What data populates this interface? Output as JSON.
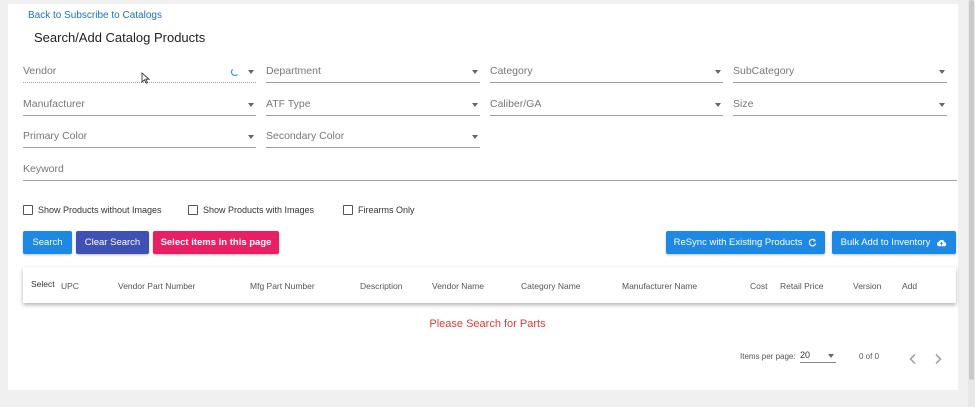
{
  "nav": {
    "back_label": "Back to Subscribe to Catalogs"
  },
  "page": {
    "title": "Search/Add Catalog Products"
  },
  "filters": {
    "vendor": "Vendor",
    "department": "Department",
    "category": "Category",
    "subcategory": "SubCategory",
    "manufacturer": "Manufacturer",
    "atf_type": "ATF Type",
    "caliber": "Caliber/GA",
    "size": "Size",
    "primary_color": "Primary Color",
    "secondary_color": "Secondary Color",
    "keyword": "Keyword"
  },
  "checkboxes": {
    "without_images": "Show Products without Images",
    "with_images": "Show Products with Images",
    "firearms_only": "Firearms Only"
  },
  "buttons": {
    "search": "Search",
    "clear": "Clear Search",
    "select_page": "Select items in this page",
    "resync": "ReSync with Existing Products",
    "bulk_add": "Bulk Add to Inventory"
  },
  "table": {
    "columns": [
      "Select",
      "UPC",
      "Vendor Part Number",
      "Mfg Part Number",
      "Description",
      "Vendor Name",
      "Category Name",
      "Manufacturer Name",
      "Cost",
      "Retail Price",
      "Version",
      "Add"
    ],
    "empty_message": "Please Search for Parts"
  },
  "pagination": {
    "items_per_page_label": "Items per page:",
    "items_per_page": "20",
    "range": "0 of 0"
  },
  "colors": {
    "primary": "#1e88e5",
    "indigo": "#3f51b5",
    "accent": "#e91e63",
    "warn": "#e53935"
  },
  "icons": {
    "resync": "refresh-icon",
    "bulk_add": "cloud-upload-icon",
    "prev": "chevron-left-icon",
    "next": "chevron-right-icon",
    "loading": "spinner-icon"
  }
}
